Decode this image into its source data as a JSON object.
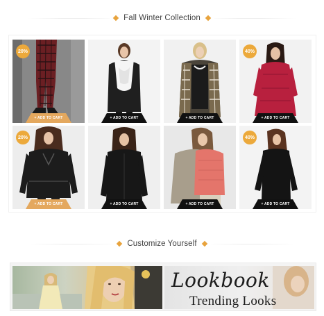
{
  "colors": {
    "accent": "#eca93b",
    "cart_dark": "#111111",
    "cart_light": "#e4a85e"
  },
  "sections": {
    "collection": {
      "title": "Fall Winter Collection"
    },
    "customize": {
      "title": "Customize Yourself"
    }
  },
  "products": [
    {
      "badge": "20%",
      "cart_label": "+ ADD TO CART",
      "cart_style": "orange",
      "image": "plaid-leggings-boots"
    },
    {
      "badge": "",
      "cart_label": "+ ADD TO CART",
      "cart_style": "dark",
      "image": "white-scarf-leather-jacket"
    },
    {
      "badge": "",
      "cart_label": "+ ADD TO CART",
      "cart_style": "dark",
      "image": "plaid-coat-black-dress"
    },
    {
      "badge": "40%",
      "cart_label": "+ ADD TO CART",
      "cart_style": "dark",
      "image": "red-lace-dress"
    },
    {
      "badge": "20%",
      "cart_label": "+ ADD TO CART",
      "cart_style": "orange",
      "image": "black-biker-jacket"
    },
    {
      "badge": "",
      "cart_label": "+ ADD TO CART",
      "cart_style": "dark",
      "image": "black-leather-jacket"
    },
    {
      "badge": "",
      "cart_label": "+ ADD TO CART",
      "cart_style": "dark",
      "image": "beige-jacket-pink-sweater"
    },
    {
      "badge": "40%",
      "cart_label": "+ ADD TO CART",
      "cart_style": "dark",
      "image": "black-long-sleeve-top"
    }
  ],
  "banner": {
    "lookbook_title": "Lookbook",
    "lookbook_subtitle": "Trending Looks"
  }
}
